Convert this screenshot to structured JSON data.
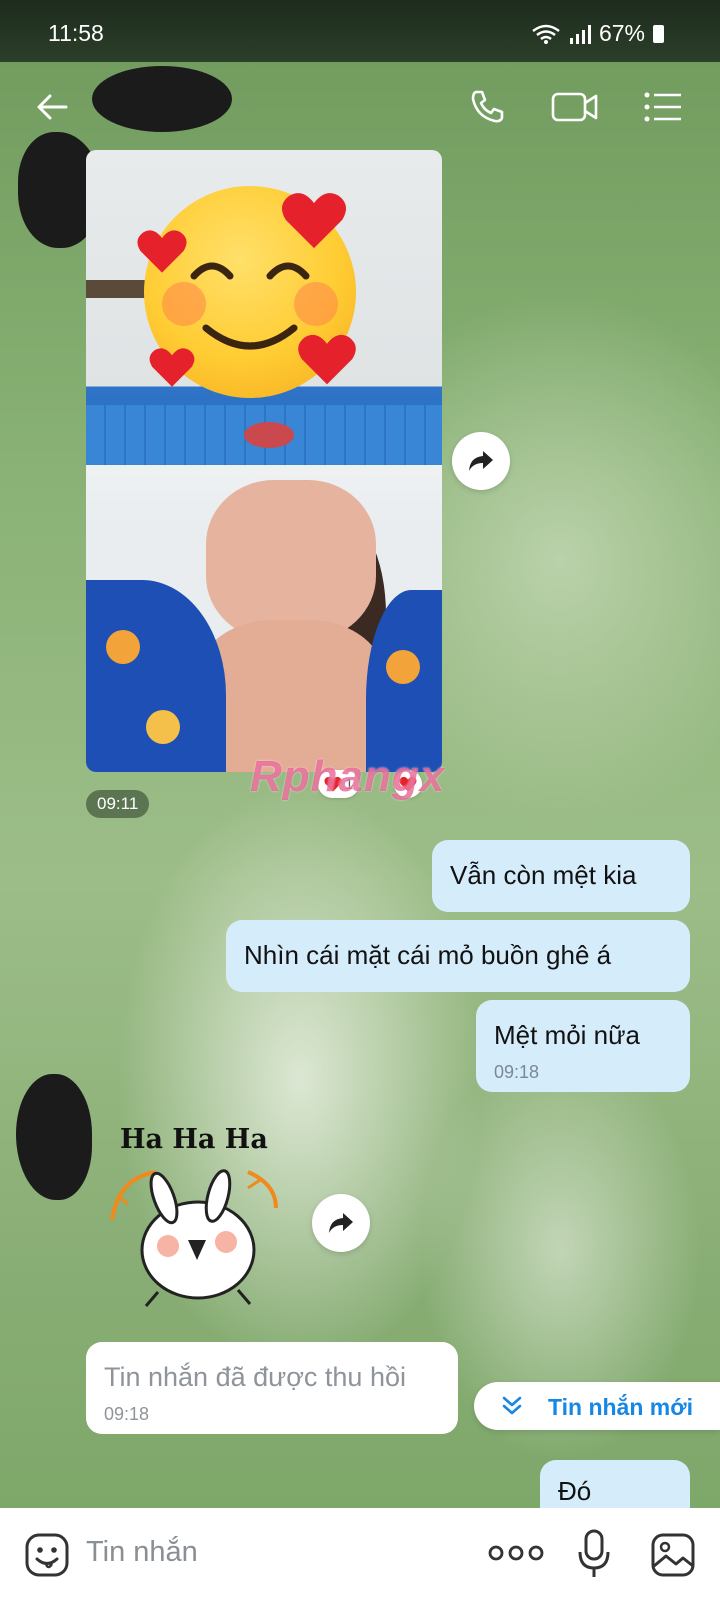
{
  "status_bar": {
    "time": "11:58",
    "battery": "67%"
  },
  "header": {
    "back_icon": "arrow-left-icon",
    "call_icon": "phone-icon",
    "video_icon": "video-camera-icon",
    "menu_icon": "list-menu-icon"
  },
  "messages": {
    "photo_time": "09:11",
    "photo_reaction_count": "1",
    "watermark": "Rphangx",
    "outgoing": [
      {
        "text": "Vẫn còn mệt kia"
      },
      {
        "text": "Nhìn cái mặt cái mỏ buồn ghê á"
      },
      {
        "text": "Mệt mỏi nữa",
        "time": "09:18"
      }
    ],
    "sticker_text": "Ha Ha Ha",
    "recalled": {
      "text": "Tin nhắn đã được thu hồi",
      "time": "09:18"
    },
    "last_outgoing": "Đó"
  },
  "new_message_button": {
    "label": "Tin nhắn mới",
    "icon": "double-chevron-down-icon"
  },
  "composer": {
    "placeholder": "Tin nhắn",
    "emoji_icon": "emoji-face-icon",
    "more_icon": "more-dots-icon",
    "mic_icon": "microphone-icon",
    "image_icon": "image-icon"
  },
  "colors": {
    "outgoing_bubble": "#d5ecfb",
    "accent": "#1787e5"
  }
}
